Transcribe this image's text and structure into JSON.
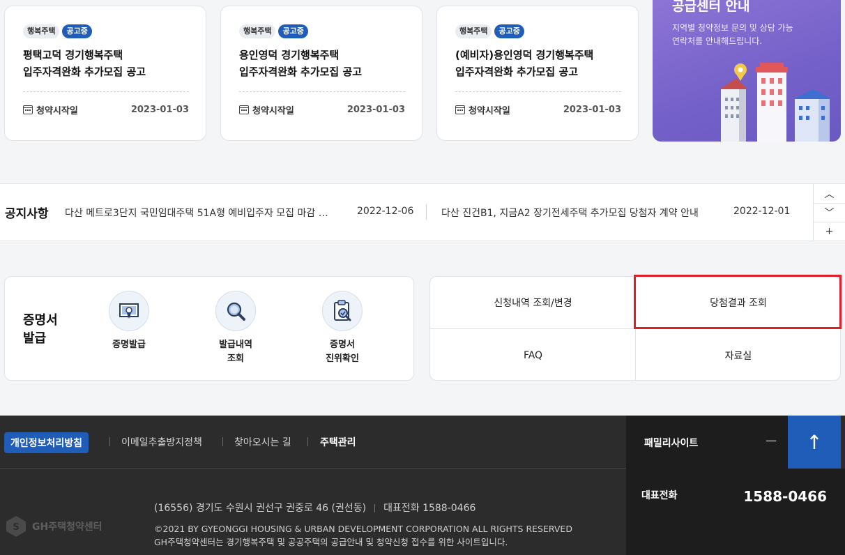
{
  "cards": [
    {
      "badge_type": "행복주택",
      "badge_status": "공고중",
      "title": "평택고덕 경기행복주택\n입주자격완화 추가모집 공고",
      "date_label": "청약시작일",
      "date": "2023-01-03"
    },
    {
      "badge_type": "행복주택",
      "badge_status": "공고중",
      "title": "용인영덕 경기행복주택\n입주자격완화 추가모집 공고",
      "date_label": "청약시작일",
      "date": "2023-01-03"
    },
    {
      "badge_type": "행복주택",
      "badge_status": "공고중",
      "title": "(예비자)용인영덕 경기행복주택\n입주자격완화 추가모집 공고",
      "date_label": "청약시작일",
      "date": "2023-01-03"
    }
  ],
  "promo": {
    "title": "공급센터 안내",
    "desc": "지역별 청약정보 문의 및 상담 가능\n연락처를 안내해드립니다."
  },
  "notice": {
    "label": "공지사항",
    "items": [
      {
        "text": "다산 메트로3단지 국민임대주택 51A형 예비입주자 모집 마감 …",
        "date": "2022-12-06"
      },
      {
        "text": "다산 진건B1, 지금A2 장기전세주택 추가모집 당첨자 계약 안내",
        "date": "2022-12-01"
      }
    ],
    "up": "︿",
    "down": "﹀",
    "more": "+"
  },
  "cert": {
    "title": "증명서\n발급",
    "items": [
      {
        "label": "증명발급",
        "icon": "certificate-icon"
      },
      {
        "label": "발급내역\n조회",
        "icon": "search-icon"
      },
      {
        "label": "증명서\n진위확인",
        "icon": "document-check-icon"
      }
    ]
  },
  "quick": {
    "apply_history": "신청내역 조회/변경",
    "win_result": "당첨결과 조회",
    "faq": "FAQ",
    "archive": "자료실"
  },
  "footer": {
    "privacy": "개인정보처리방침",
    "email_policy": "이메일추출방지정책",
    "directions": "찾아오시는 길",
    "housing_mgmt": "주택관리",
    "family_site": "패밀리사이트",
    "family_toggle": "—",
    "to_top": "↑",
    "phone_label": "대표전화",
    "phone_number": "1588-0466",
    "logo_text": "GH주택청약센터",
    "address": "(16556) 경기도 수원시 권선구 권중로 46 (권선동)",
    "address_phone": "대표전화 1588-0466",
    "copyright": "©2021 BY GYEONGGI HOUSING & URBAN DEVELOPMENT CORPORATION ALL RIGHTS RESERVED\nGH주택청약센터는 경기행복주택 및 공공주택의 공급안내 및 청약신청 접수를 위한 사이트입니다."
  }
}
